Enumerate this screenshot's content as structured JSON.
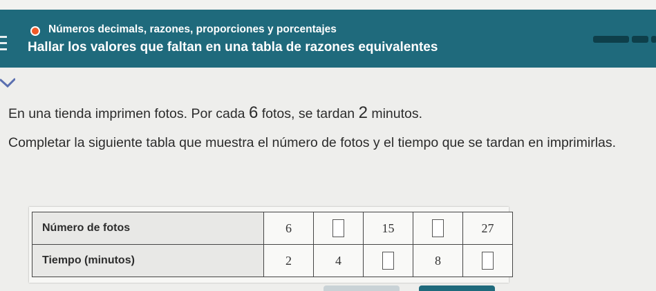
{
  "header": {
    "topic": "Números decimals, razones, proporciones y porcentajes",
    "title": "Hallar los valores que faltan en una tabla de razones equivalentes"
  },
  "colors": {
    "header_bg": "#1f6a7c",
    "topic_dot": "#f05a28",
    "progress": "#0e3f4a",
    "check": "#5a6fb0"
  },
  "problem": {
    "statement_pre": "En una tienda imprimen fotos. Por cada ",
    "photos": "6",
    "statement_mid": " fotos, se tardan ",
    "minutes": "2",
    "statement_post": " minutos.",
    "instruction": "Completar la siguiente tabla que muestra el número de fotos y el tiempo que se tardan en imprimirlas."
  },
  "table": {
    "rows": [
      {
        "label": "Número de fotos",
        "values": [
          "6",
          "",
          "15",
          "",
          "27"
        ]
      },
      {
        "label": "Tiempo (minutos)",
        "values": [
          "2",
          "4",
          "",
          "8",
          ""
        ]
      }
    ]
  }
}
